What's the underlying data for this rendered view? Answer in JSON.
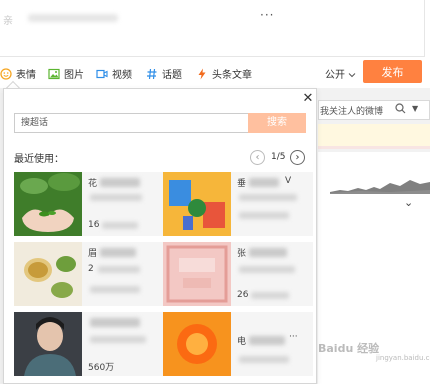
{
  "composer": {
    "text": "亲"
  },
  "toolbar": {
    "emoji_label": "表情",
    "image_label": "图片",
    "video_label": "视频",
    "topic_label": "话题",
    "headline_label": "头条文章",
    "more_label": "···",
    "visibility": "公开",
    "post_label": "发布"
  },
  "feed": {
    "search_placeholder": "我关注人的微博"
  },
  "topic_popup": {
    "search_placeholder": "搜超话",
    "search_button": "搜索",
    "recent_label": "最近使用：",
    "page": "1/5",
    "cards": [
      {
        "title": "花",
        "stat": "16"
      },
      {
        "title": "垂",
        "suffix": "V"
      },
      {
        "title": "眉",
        "stat": "2"
      },
      {
        "title": "张",
        "stat": "26"
      },
      {
        "title": "",
        "stat": "560万"
      },
      {
        "title": "电",
        "more": "···"
      }
    ]
  },
  "watermark": {
    "main": "Baidu 经验",
    "sub": "jingyan.baidu.com"
  },
  "colors": {
    "accent": "#ff8140",
    "search_btn": "#ffc09f"
  }
}
